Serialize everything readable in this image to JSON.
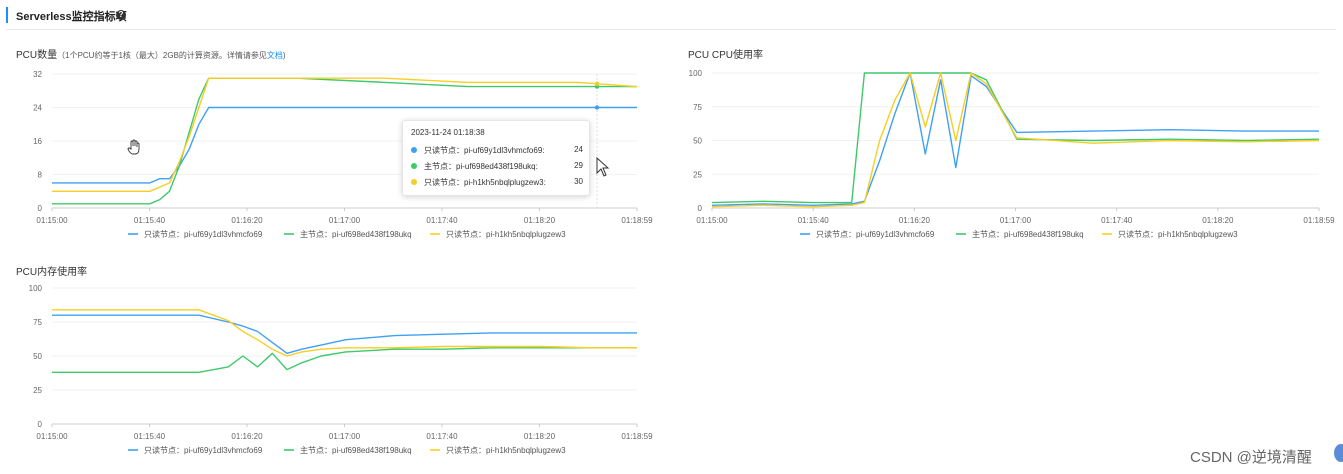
{
  "header": {
    "title": "Serverless监控指标项",
    "help_icon": "question-circle-icon"
  },
  "colors": {
    "read1": "#3fa0f5",
    "primary": "#3ec96b",
    "read2": "#f7ce23",
    "axis": "#cccccc",
    "grid": "#f2f2f2",
    "text": "#666666",
    "link": "#1890ff"
  },
  "charts": {
    "pcu": {
      "title": "PCU数量",
      "note": "（1个PCU约等于1核（最大）2GB的计算资源。详情请参见",
      "link": "文档",
      "note_end": ")"
    },
    "cpu": {
      "title": "PCU CPU使用率"
    },
    "mem": {
      "title": "PCU内存使用率"
    }
  },
  "legend": [
    {
      "name": "只读节点：pi-uf69y1dl3vhmcfo69"
    },
    {
      "name": "主节点：pi-uf698ed438f198ukq"
    },
    {
      "name": "只读节点：pi-h1kh5nbqlplugzew3"
    }
  ],
  "tooltip": {
    "time": "2023-11-24 01:18:38",
    "rows": [
      {
        "name": "只读节点：pi-uf69y1dl3vhmcfo69:",
        "value": "24"
      },
      {
        "name": "主节点：pi-uf698ed438f198ukq:",
        "value": "29"
      },
      {
        "name": "只读节点：pi-h1kh5nbqlplugzew3:",
        "value": "30"
      }
    ]
  },
  "watermark": "CSDN @逆境清醒",
  "chart_data": [
    {
      "type": "line",
      "title": "PCU数量",
      "x_ticks": [
        "01:15:00",
        "01:15:40",
        "01:16:20",
        "01:17:00",
        "01:17:40",
        "01:18:20",
        "01:18:59"
      ],
      "y_ticks": [
        "0",
        "8",
        "16",
        "24",
        "32"
      ],
      "ylim": [
        0,
        32
      ],
      "x": [
        0,
        35,
        40,
        44,
        48,
        52,
        56,
        60,
        64,
        70,
        78,
        100,
        136,
        170,
        199,
        215,
        239
      ],
      "series": [
        {
          "name": "只读节点：pi-uf69y1dl3vhmcfo69",
          "values": [
            6,
            6,
            6,
            7,
            7,
            10,
            14,
            20,
            24,
            24,
            24,
            24,
            24,
            24,
            24,
            24,
            24
          ]
        },
        {
          "name": "主节点：pi-uf698ed438f198ukq",
          "values": [
            1,
            1,
            1,
            2,
            4,
            10,
            18,
            26,
            31,
            31,
            31,
            31,
            30,
            29,
            29,
            29,
            29
          ]
        },
        {
          "name": "只读节点：pi-h1kh5nbqlplugzew3",
          "values": [
            4,
            4,
            4,
            5,
            6,
            11,
            17,
            24,
            31,
            31,
            31,
            31,
            31,
            30,
            30,
            30,
            29
          ]
        }
      ]
    },
    {
      "type": "line",
      "title": "PCU CPU使用率",
      "x_ticks": [
        "01:15:00",
        "01:15:40",
        "01:16:20",
        "01:17:00",
        "01:17:40",
        "01:18:20",
        "01:18:59"
      ],
      "y_ticks": [
        "0",
        "25",
        "50",
        "75",
        "100"
      ],
      "ylim": [
        0,
        100
      ],
      "x": [
        0,
        20,
        40,
        55,
        60,
        66,
        72,
        78,
        84,
        90,
        96,
        102,
        108,
        120,
        150,
        180,
        210,
        239
      ],
      "series": [
        {
          "name": "只读节点：pi-uf69y1dl3vhmcfo69",
          "values": [
            2,
            3,
            2,
            3,
            5,
            35,
            70,
            100,
            40,
            95,
            30,
            98,
            90,
            56,
            57,
            58,
            57,
            57
          ]
        },
        {
          "name": "主节点：pi-uf698ed438f198ukq",
          "values": [
            4,
            5,
            4,
            4,
            100,
            100,
            100,
            100,
            100,
            100,
            100,
            100,
            95,
            51,
            50,
            51,
            50,
            51
          ]
        },
        {
          "name": "只读节点：pi-h1kh5nbqlplugzew3",
          "values": [
            1,
            2,
            1,
            2,
            4,
            50,
            80,
            100,
            60,
            100,
            50,
            100,
            92,
            52,
            48,
            50,
            49,
            50
          ]
        }
      ]
    },
    {
      "type": "line",
      "title": "PCU内存使用率",
      "x_ticks": [
        "01:15:00",
        "01:15:40",
        "01:16:20",
        "01:17:00",
        "01:17:40",
        "01:18:20",
        "01:18:59"
      ],
      "y_ticks": [
        "0",
        "25",
        "50",
        "75",
        "100"
      ],
      "ylim": [
        0,
        100
      ],
      "x": [
        0,
        30,
        60,
        72,
        78,
        84,
        90,
        96,
        102,
        110,
        120,
        140,
        160,
        180,
        200,
        220,
        239
      ],
      "series": [
        {
          "name": "只读节点：pi-uf69y1dl3vhmcfo69",
          "values": [
            80,
            80,
            80,
            75,
            72,
            68,
            60,
            52,
            55,
            58,
            62,
            65,
            66,
            67,
            67,
            67,
            67
          ]
        },
        {
          "name": "主节点：pi-uf698ed438f198ukq",
          "values": [
            38,
            38,
            38,
            42,
            50,
            42,
            52,
            40,
            45,
            50,
            53,
            55,
            55,
            56,
            56,
            56,
            56
          ]
        },
        {
          "name": "只读节点：pi-h1kh5nbqlplugzew3",
          "values": [
            84,
            84,
            84,
            76,
            68,
            62,
            55,
            50,
            53,
            55,
            56,
            56,
            57,
            57,
            57,
            56,
            56
          ]
        }
      ]
    }
  ]
}
